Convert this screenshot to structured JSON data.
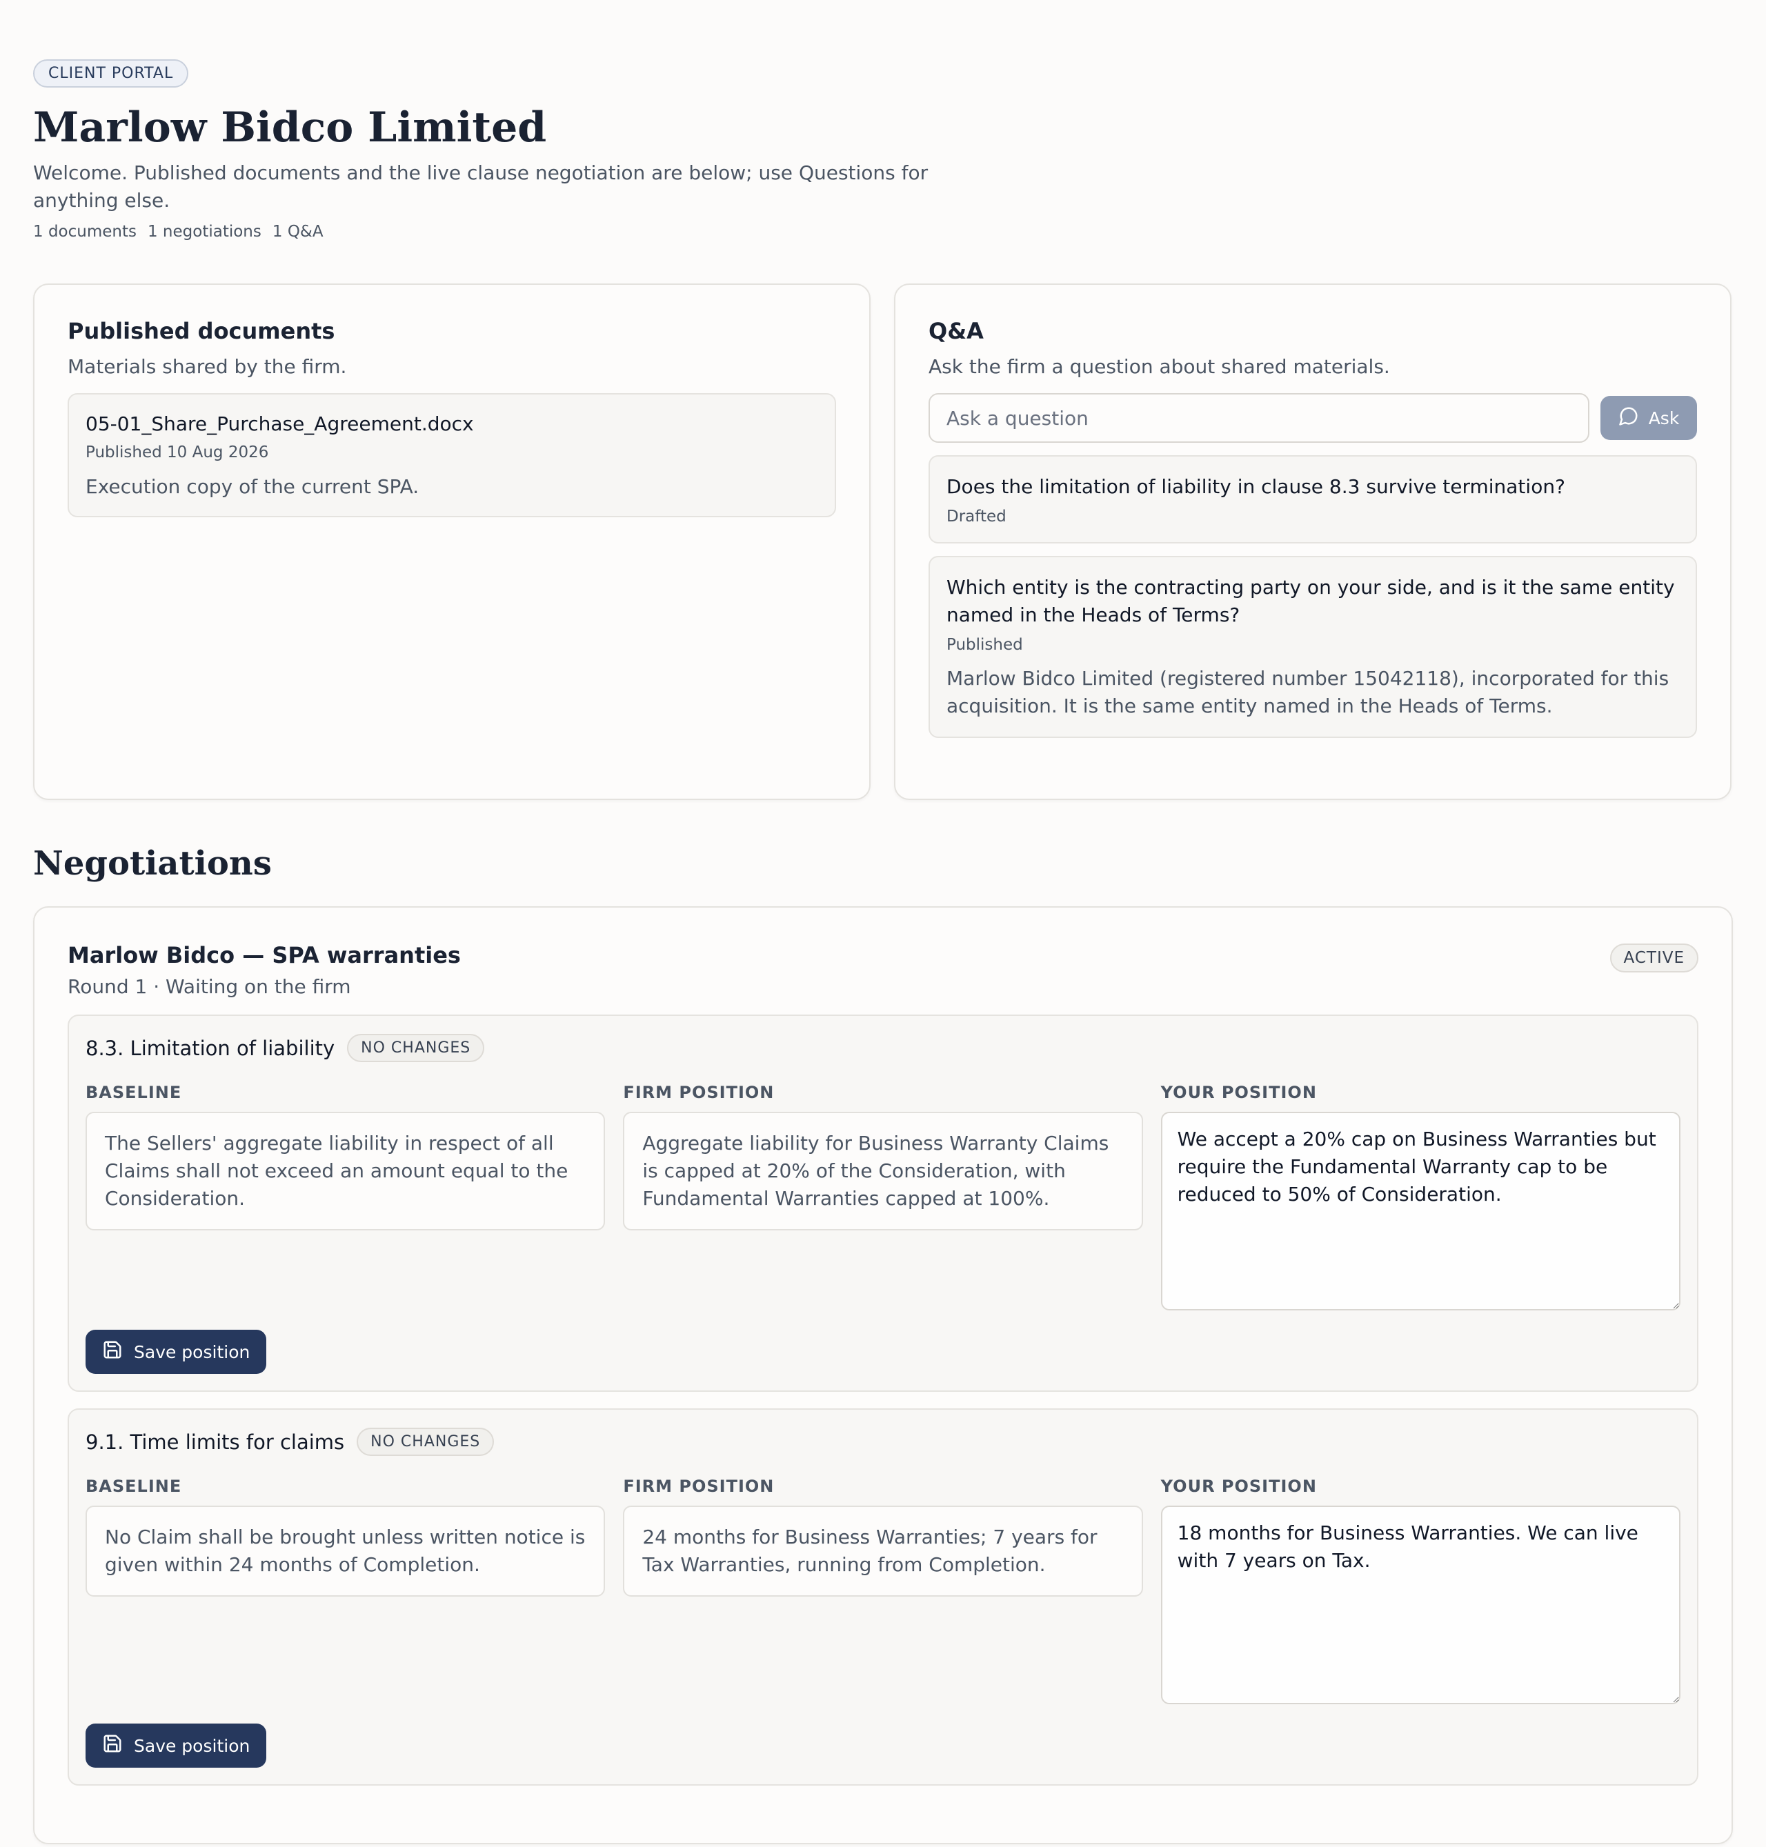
{
  "header": {
    "badge": "CLIENT PORTAL",
    "title": "Marlow Bidco Limited",
    "intro": "Welcome. Published documents and the live clause negotiation are below; use Questions for anything else.",
    "counts": [
      "1 documents",
      "1 negotiations",
      "1 Q&A"
    ]
  },
  "documents": {
    "title": "Published documents",
    "subtitle": "Materials shared by the firm.",
    "items": [
      {
        "name": "05-01_Share_Purchase_Agreement.docx",
        "published": "Published 10 Aug 2026",
        "description": "Execution copy of the current SPA."
      }
    ]
  },
  "qa": {
    "title": "Q&A",
    "subtitle": "Ask the firm a question about shared materials.",
    "input_placeholder": "Ask a question",
    "input_value": "",
    "ask_label": "Ask",
    "items": [
      {
        "question": "Does the limitation of liability in clause 8.3 survive termination?",
        "status": "Drafted",
        "answer": ""
      },
      {
        "question": "Which entity is the contracting party on your side, and is it the same entity named in the Heads of Terms?",
        "status": "Published",
        "answer": "Marlow Bidco Limited (registered number 15042118), incorporated for this acquisition. It is the same entity named in the Heads of Terms."
      }
    ]
  },
  "negotiations": {
    "section_title": "Negotiations",
    "items": [
      {
        "title": "Marlow Bidco — SPA warranties",
        "subtitle": "Round 1 · Waiting on the firm",
        "status": "ACTIVE",
        "labels": {
          "baseline": "BASELINE",
          "firm": "FIRM POSITION",
          "yours": "YOUR POSITION",
          "save": "Save position"
        },
        "clauses": [
          {
            "title": "8.3. Limitation of liability",
            "badge": "NO CHANGES",
            "baseline": "The Sellers' aggregate liability in respect of all Claims shall not exceed an amount equal to the Consideration.",
            "firm_position": "Aggregate liability for Business Warranty Claims is capped at 20% of the Consideration, with Fundamental Warranties capped at 100%.",
            "your_position": "We accept a 20% cap on Business Warranties but require the Fundamental Warranty cap to be reduced to 50% of Consideration."
          },
          {
            "title": "9.1. Time limits for claims",
            "badge": "NO CHANGES",
            "baseline": "No Claim shall be brought unless written notice is given within 24 months of Completion.",
            "firm_position": "24 months for Business Warranties; 7 years for Tax Warranties, running from Completion.",
            "your_position": "18 months for Business Warranties. We can live with 7 years on Tax."
          }
        ]
      }
    ]
  },
  "icons": {
    "ask": "chat-bubble-icon",
    "save": "floppy-disk-icon"
  },
  "colors": {
    "primary_button": "#26385d",
    "ask_button": "#8e9bb2",
    "background": "#fcfbfa"
  }
}
